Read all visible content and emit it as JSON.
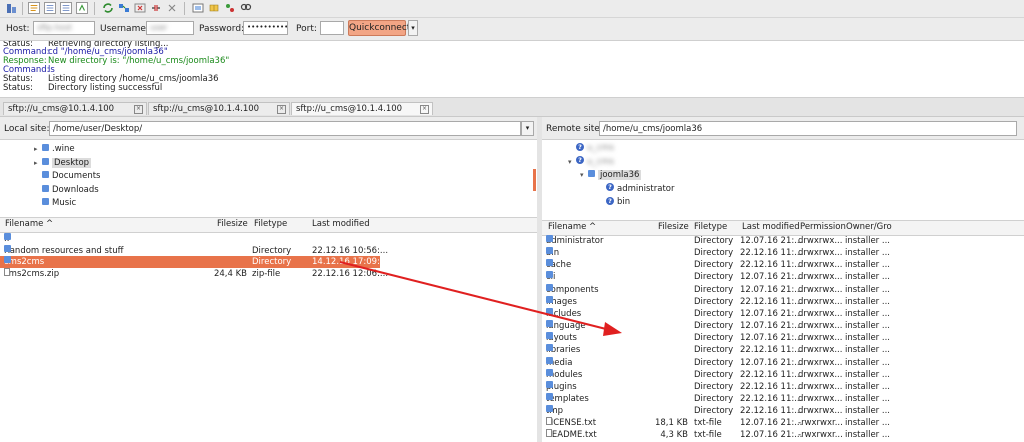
{
  "quickconnect": {
    "host_label": "Host:",
    "host_value": "sftp.host",
    "username_label": "Username:",
    "username_value": "user",
    "password_label": "Password:",
    "password_value": "•••••••••••••",
    "port_label": "Port:",
    "port_value": "",
    "button_label": "Quickconnect",
    "dropdown_glyph": "▾"
  },
  "log": [
    {
      "kind": "Status:",
      "text": "Retrieving directory listing...",
      "color": "#222222"
    },
    {
      "kind": "Command:",
      "text": "cd \"/home/u_cms/joomla36\"",
      "color": "#1a1aa6"
    },
    {
      "kind": "Response:",
      "text": "New directory is: \"/home/u_cms/joomla36\"",
      "color": "#1a8a1a"
    },
    {
      "kind": "Command:",
      "text": "ls",
      "color": "#1a1aa6"
    },
    {
      "kind": "Status:",
      "text": "Listing directory /home/u_cms/joomla36",
      "color": "#222222"
    },
    {
      "kind": "Status:",
      "text": "Directory listing successful",
      "color": "#222222"
    }
  ],
  "tabs": [
    {
      "label": "sftp://u_cms@10.1.4.100"
    },
    {
      "label": "sftp://u_cms@10.1.4.100"
    },
    {
      "label": "sftp://u_cms@10.1.4.100"
    }
  ],
  "local": {
    "site_label": "Local site:",
    "path": "/home/user/Desktop/",
    "tree": [
      {
        "label": ".wine",
        "expander": "▸"
      },
      {
        "label": "Desktop",
        "expander": "▸"
      },
      {
        "label": "Documents",
        "expander": ""
      },
      {
        "label": "Downloads",
        "expander": ""
      },
      {
        "label": "Music",
        "expander": ""
      }
    ],
    "columns": [
      "Filename",
      "Filesize",
      "Filetype",
      "Last modified"
    ],
    "sort_glyph": "^",
    "files": [
      {
        "name": "..",
        "size": "",
        "type": "",
        "modified": ""
      },
      {
        "name": "Random resources and stuff",
        "size": "",
        "type": "Directory",
        "modified": "22.12.16 10:56:..."
      },
      {
        "name": "cms2cms",
        "size": "",
        "type": "Directory",
        "modified": "14.12.16 17:09:..."
      },
      {
        "name": "cms2cms.zip",
        "size": "24,4 KB",
        "type": "zip-file",
        "modified": "22.12.16 12:06:..."
      }
    ]
  },
  "remote": {
    "site_label": "Remote site:",
    "path": "/home/u_cms/joomla36",
    "tree": [
      {
        "label": "u_cms",
        "expander": ""
      },
      {
        "label": "u_cms",
        "expander": "▾"
      },
      {
        "label": "joomla36",
        "expander": "▾"
      },
      {
        "label": "administrator",
        "expander": ""
      },
      {
        "label": "bin",
        "expander": ""
      }
    ],
    "columns": [
      "Filename",
      "Filesize",
      "Filetype",
      "Last modified",
      "Permission",
      "Owner/Gro"
    ],
    "sort_glyph": "^",
    "files": [
      {
        "name": "administrator",
        "size": "",
        "type": "Directory",
        "modified": "12.07.16 21:...",
        "perm": "drwxrwx...",
        "owner": "installer ..."
      },
      {
        "name": "bin",
        "size": "",
        "type": "Directory",
        "modified": "22.12.16 11:...",
        "perm": "drwxrwx...",
        "owner": "installer ..."
      },
      {
        "name": "cache",
        "size": "",
        "type": "Directory",
        "modified": "22.12.16 11:...",
        "perm": "drwxrwx...",
        "owner": "installer ..."
      },
      {
        "name": "cli",
        "size": "",
        "type": "Directory",
        "modified": "12.07.16 21:...",
        "perm": "drwxrwx...",
        "owner": "installer ..."
      },
      {
        "name": "components",
        "size": "",
        "type": "Directory",
        "modified": "12.07.16 21:...",
        "perm": "drwxrwx...",
        "owner": "installer ..."
      },
      {
        "name": "images",
        "size": "",
        "type": "Directory",
        "modified": "22.12.16 11:...",
        "perm": "drwxrwx...",
        "owner": "installer ..."
      },
      {
        "name": "includes",
        "size": "",
        "type": "Directory",
        "modified": "12.07.16 21:...",
        "perm": "drwxrwx...",
        "owner": "installer ..."
      },
      {
        "name": "language",
        "size": "",
        "type": "Directory",
        "modified": "12.07.16 21:...",
        "perm": "drwxrwx...",
        "owner": "installer ..."
      },
      {
        "name": "layouts",
        "size": "",
        "type": "Directory",
        "modified": "12.07.16 21:...",
        "perm": "drwxrwx...",
        "owner": "installer ..."
      },
      {
        "name": "libraries",
        "size": "",
        "type": "Directory",
        "modified": "22.12.16 11:...",
        "perm": "drwxrwx...",
        "owner": "installer ..."
      },
      {
        "name": "media",
        "size": "",
        "type": "Directory",
        "modified": "12.07.16 21:...",
        "perm": "drwxrwx...",
        "owner": "installer ..."
      },
      {
        "name": "modules",
        "size": "",
        "type": "Directory",
        "modified": "22.12.16 11:...",
        "perm": "drwxrwx...",
        "owner": "installer ..."
      },
      {
        "name": "plugins",
        "size": "",
        "type": "Directory",
        "modified": "22.12.16 11:...",
        "perm": "drwxrwx...",
        "owner": "installer ..."
      },
      {
        "name": "templates",
        "size": "",
        "type": "Directory",
        "modified": "22.12.16 11:...",
        "perm": "drwxrwx...",
        "owner": "installer ..."
      },
      {
        "name": "tmp",
        "size": "",
        "type": "Directory",
        "modified": "22.12.16 11:...",
        "perm": "drwxrwx...",
        "owner": "installer ..."
      },
      {
        "name": "LICENSE.txt",
        "size": "18,1 KB",
        "type": "txt-file",
        "modified": "12.07.16 21:...",
        "perm": "-rwxrwxr...",
        "owner": "installer ..."
      },
      {
        "name": "README.txt",
        "size": "4,3 KB",
        "type": "txt-file",
        "modified": "12.07.16 21:...",
        "perm": "-rwxrwxr...",
        "owner": "installer ..."
      }
    ]
  },
  "colors": {
    "selection": "#e8734a",
    "arrow": "#e02020",
    "folder": "#5a8edc",
    "quickconnect": "#f2a585"
  }
}
